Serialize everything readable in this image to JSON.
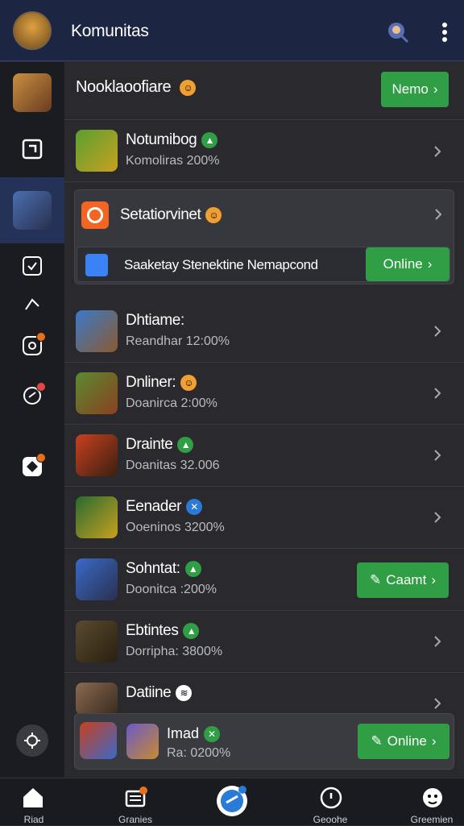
{
  "header": {
    "title": "Komunitas"
  },
  "section": {
    "title": "Nooklaoofiare",
    "action_label": "Nemo"
  },
  "rows_top": [
    {
      "name": "Notumibog",
      "sub": "Komoliras 200%"
    }
  ],
  "card": {
    "title": "Setatiorvinet",
    "inner_text": "Saaketay Stenektine Nemapcond",
    "inner_button": "Online"
  },
  "rows": [
    {
      "name": "Dhtiame:",
      "sub": "Reandhar 12:00%"
    },
    {
      "name": "Dnliner:",
      "sub": "Doanirca 2:00%"
    },
    {
      "name": "Drainte",
      "sub": "Doanitas 32.006"
    },
    {
      "name": "Eenader",
      "sub": "Ooeninos 3200%"
    },
    {
      "name": "Sohntat:",
      "sub": "Doonitca :200%",
      "button": "Caamt"
    },
    {
      "name": "Ebtintes",
      "sub": "Dorripha: 3800%"
    },
    {
      "name": "Datiine",
      "sub": ""
    }
  ],
  "floating": {
    "name": "Imad",
    "sub": "Ra: 0200%",
    "button": "Online"
  },
  "bottom_nav": [
    "Riad",
    "Granies",
    "",
    "Geoohe",
    "Greemien"
  ],
  "colors": {
    "accent_green": "#2f9e44",
    "header_bg": "#1c2542",
    "active_rail": "#253258"
  }
}
